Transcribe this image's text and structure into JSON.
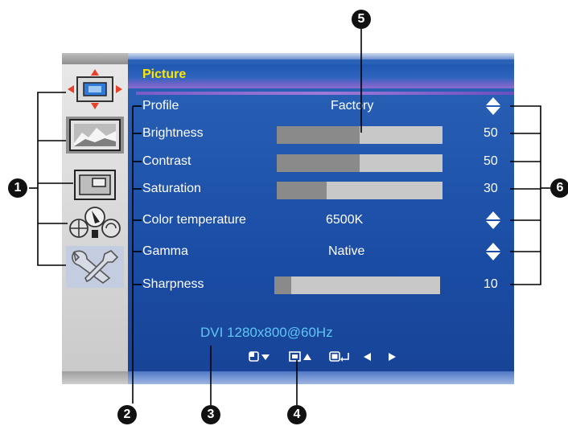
{
  "menu": {
    "title": "Picture",
    "sidebar_icons": [
      "picture-position-icon",
      "picture-icon",
      "window-icon",
      "color-settings-icon",
      "tools-icon"
    ],
    "items": [
      {
        "label": "Profile",
        "value": "Factory",
        "control": "up-down-arrows"
      },
      {
        "label": "Brightness",
        "value": "50",
        "level": 0.5,
        "control": "slider"
      },
      {
        "label": "Contrast",
        "value": "50",
        "level": 0.5,
        "control": "slider"
      },
      {
        "label": "Saturation",
        "value": "30",
        "level": 0.3,
        "control": "slider"
      },
      {
        "label": "Color temperature",
        "value": "6500K",
        "control": "up-down-arrows"
      },
      {
        "label": "Gamma",
        "value": "Native",
        "control": "up-down-arrows"
      },
      {
        "label": "Sharpness",
        "value": "10",
        "level": 0.1,
        "control": "slider"
      }
    ],
    "input_status": "DVI 1280x800@60Hz",
    "key_icons": [
      "window-down-key-icon",
      "resize-up-key-icon",
      "enter-key-icon",
      "left-arrow-key-icon",
      "right-arrow-key-icon"
    ]
  },
  "callouts": [
    "1",
    "2",
    "3",
    "4",
    "5",
    "6"
  ],
  "colors": {
    "panel_blue": "#1b4da5",
    "title_yellow": "#ffe600",
    "status_cyan": "#5fc6f5",
    "slider_track": "#c8c8c8",
    "slider_fill": "#8a8a8a"
  }
}
